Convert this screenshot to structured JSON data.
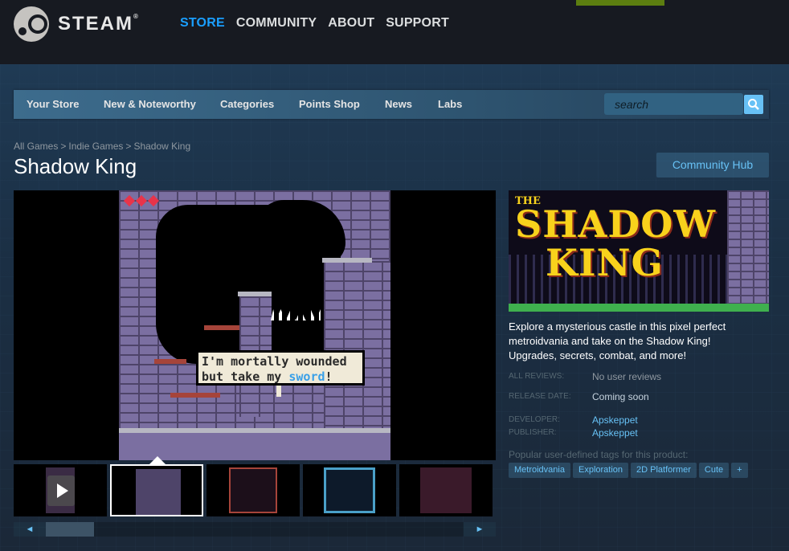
{
  "header": {
    "brand": "STEAM",
    "nav": [
      "STORE",
      "COMMUNITY",
      "ABOUT",
      "SUPPORT"
    ],
    "active_nav": "STORE"
  },
  "store_nav": {
    "items": [
      "Your Store",
      "New & Noteworthy",
      "Categories",
      "Points Shop",
      "News",
      "Labs"
    ],
    "search_placeholder": "search"
  },
  "breadcrumb": [
    "All Games",
    "Indie Games",
    "Shadow King"
  ],
  "game": {
    "title": "Shadow King",
    "community_hub": "Community Hub",
    "screenshot_text_line1": "I'm mortally wounded",
    "screenshot_text_line2_pre": "but take my ",
    "screenshot_text_highlight": "sword",
    "screenshot_text_line2_post": "!",
    "capsule_the": "THE",
    "capsule_word1": "SHADOW",
    "capsule_word2": "KING",
    "description": "Explore a mysterious castle in this pixel perfect metroidvania and take on the Shadow King! Upgrades, secrets, combat, and more!",
    "all_reviews_label": "ALL REVIEWS:",
    "all_reviews_value": "No user reviews",
    "release_label": "RELEASE DATE:",
    "release_value": "Coming soon",
    "developer_label": "DEVELOPER:",
    "developer_value": "Apskeppet",
    "publisher_label": "PUBLISHER:",
    "publisher_value": "Apskeppet",
    "tags_label": "Popular user-defined tags for this product:",
    "tags": [
      "Metroidvania",
      "Exploration",
      "2D Platformer",
      "Cute",
      "+"
    ]
  },
  "slider": {
    "left_arrow": "◄",
    "right_arrow": "►"
  },
  "colors": {
    "accent": "#1a9fff",
    "link": "#67c1f5",
    "bg": "#1b2838"
  }
}
